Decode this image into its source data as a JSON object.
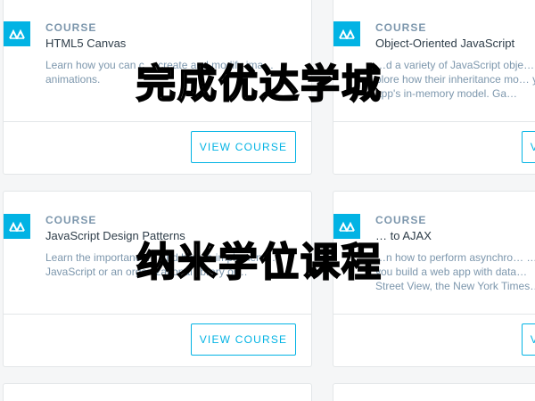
{
  "cards": [
    {
      "kicker": "COURSE",
      "title": "HTML5 Canvas",
      "desc": "Learn how you can c… create and modify ima… animations.",
      "cta": "VIEW COURSE"
    },
    {
      "kicker": "COURSE",
      "title": "Object-Oriented JavaScript",
      "desc": "…d a variety of JavaScript obje… …plore how their inheritance mo… your app's in-memory model. Ga…",
      "cta": "VIEW COURSE"
    },
    {
      "kicker": "COURSE",
      "title": "JavaScript Design Patterns",
      "desc": "Learn the importance… and how to implement… JavaScript or an organizational library or…",
      "cta": "VIEW COURSE"
    },
    {
      "kicker": "COURSE",
      "title": "… to AJAX",
      "desc": "…n how to perform asynchro… …as you build a web app with data… Street View, the New York Times…",
      "cta": "VIEW COURSE"
    }
  ],
  "watermark": {
    "line1": "完成优达学城",
    "line2": "纳米学位课程"
  },
  "colors": {
    "accent": "#02b3e4",
    "background": "#f5f6f7",
    "card_border": "#e3e6e8"
  },
  "icons": {
    "course_logo": "udacity-logo-icon"
  }
}
